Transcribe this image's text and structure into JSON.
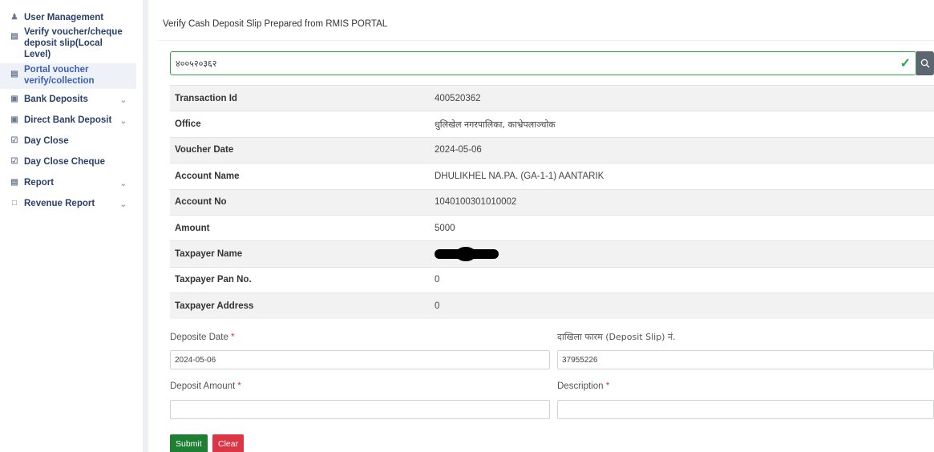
{
  "sidebar": {
    "items": [
      {
        "label": "User Management",
        "icon": "user-icon",
        "has_chevron": false,
        "active": false
      },
      {
        "label": "Verify voucher/cheque deposit slip(Local Level)",
        "icon": "document-icon",
        "has_chevron": false,
        "active": false
      },
      {
        "label": "Portal voucher verify/collection",
        "icon": "document-icon",
        "has_chevron": false,
        "active": true
      },
      {
        "label": "Bank Deposits",
        "icon": "deposit-icon",
        "has_chevron": true,
        "active": false
      },
      {
        "label": "Direct Bank Deposit",
        "icon": "deposit-icon",
        "has_chevron": true,
        "active": false
      },
      {
        "label": "Day Close",
        "icon": "calendar-check-icon",
        "has_chevron": false,
        "active": false
      },
      {
        "label": "Day Close Cheque",
        "icon": "calendar-check-icon",
        "has_chevron": false,
        "active": false
      },
      {
        "label": "Report",
        "icon": "report-icon",
        "has_chevron": true,
        "active": false
      },
      {
        "label": "Revenue Report",
        "icon": "file-icon",
        "has_chevron": true,
        "active": false
      }
    ]
  },
  "main": {
    "title": "Verify Cash Deposit Slip Prepared from RMIS PORTAL",
    "search": {
      "value": "४००५२०३६२"
    },
    "details": [
      {
        "label": "Transaction Id",
        "value": "400520362"
      },
      {
        "label": "Office",
        "value": "धुलिखेल नगरपालिका, काभ्रेपलाञ्चोक"
      },
      {
        "label": "Voucher Date",
        "value": "2024-05-06"
      },
      {
        "label": "Account Name",
        "value": "DHULIKHEL NA.PA. (GA-1-1) AANTARIK"
      },
      {
        "label": "Account No",
        "value": "1040100301010002"
      },
      {
        "label": "Amount",
        "value": "5000"
      },
      {
        "label": "Taxpayer Name",
        "value": ""
      },
      {
        "label": "Taxpayer Pan No.",
        "value": "0"
      },
      {
        "label": "Taxpayer Address",
        "value": "0"
      }
    ],
    "form": {
      "deposit_date_label": "Deposite Date",
      "deposit_date_value": "2024-05-06",
      "deposit_slip_label": "दाखिला फारम (Deposit Slip) नं.",
      "deposit_slip_value": "37955226",
      "deposit_amount_label": "Deposit Amount",
      "deposit_amount_value": "",
      "description_label": "Description",
      "description_value": "",
      "required_marker": "*"
    },
    "buttons": {
      "submit": "Submit",
      "clear": "Clear"
    }
  },
  "colors": {
    "success": "#28a745",
    "danger": "#dc3545",
    "submit": "#1e7e34",
    "nav_text": "#2a3f6b"
  }
}
